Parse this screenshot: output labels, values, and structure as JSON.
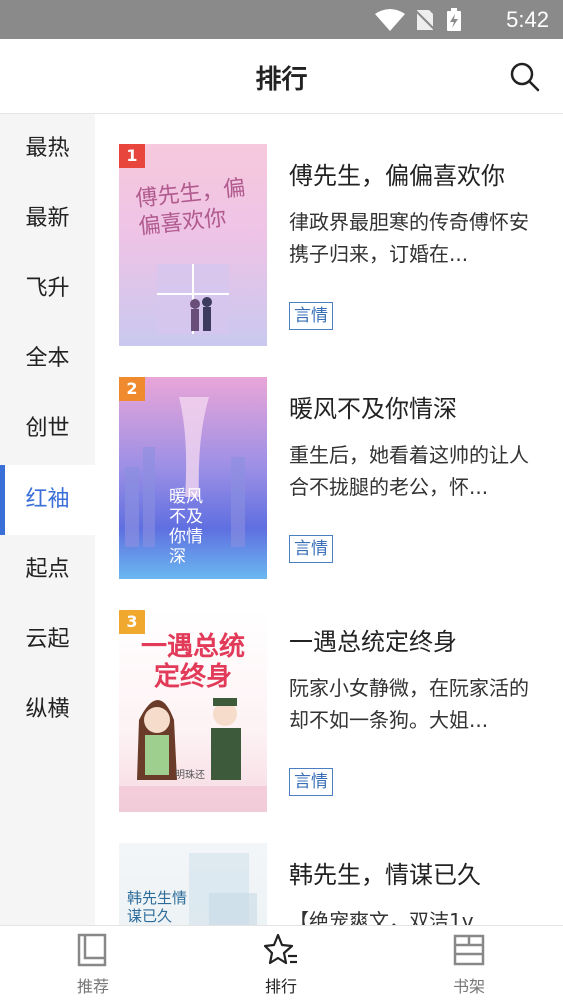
{
  "status": {
    "time": "5:42"
  },
  "header": {
    "title": "排行"
  },
  "sidebar": {
    "items": [
      {
        "label": "最热"
      },
      {
        "label": "最新"
      },
      {
        "label": "飞升"
      },
      {
        "label": "全本"
      },
      {
        "label": "创世"
      },
      {
        "label": "红袖",
        "active": true
      },
      {
        "label": "起点"
      },
      {
        "label": "云起"
      },
      {
        "label": "纵横"
      }
    ]
  },
  "books": [
    {
      "rank": "1",
      "rank_color": "#e8453c",
      "title": "傅先生，偏偏喜欢你",
      "desc": "律政界最胆寒的传奇傅怀安携子归来，订婚在...",
      "tag": "言情",
      "cover_text": "傅先生，偏偏喜欢你"
    },
    {
      "rank": "2",
      "rank_color": "#f08a2e",
      "title": "暖风不及你情深",
      "desc": "重生后，她看着这帅的让人合不拢腿的老公，怀...",
      "tag": "言情",
      "cover_text": "暖风不及你情深"
    },
    {
      "rank": "3",
      "rank_color": "#f0a82e",
      "title": "一遇总统定终身",
      "desc": "阮家小女静微，在阮家活的却不如一条狗。大姐...",
      "tag": "言情",
      "cover_text": "一遇总统定终身",
      "cover_author": "明珠还"
    },
    {
      "rank": "",
      "rank_color": "",
      "title": "韩先生，情谋已久",
      "desc": "【绝宠爽文，双洁1v",
      "tag": "",
      "cover_text": "韩先生情谋已久"
    }
  ],
  "tabbar": {
    "tabs": [
      {
        "label": "推荐",
        "icon": "book-icon"
      },
      {
        "label": "排行",
        "icon": "rank-star-icon",
        "active": true
      },
      {
        "label": "书架",
        "icon": "bookshelf-icon"
      }
    ]
  }
}
